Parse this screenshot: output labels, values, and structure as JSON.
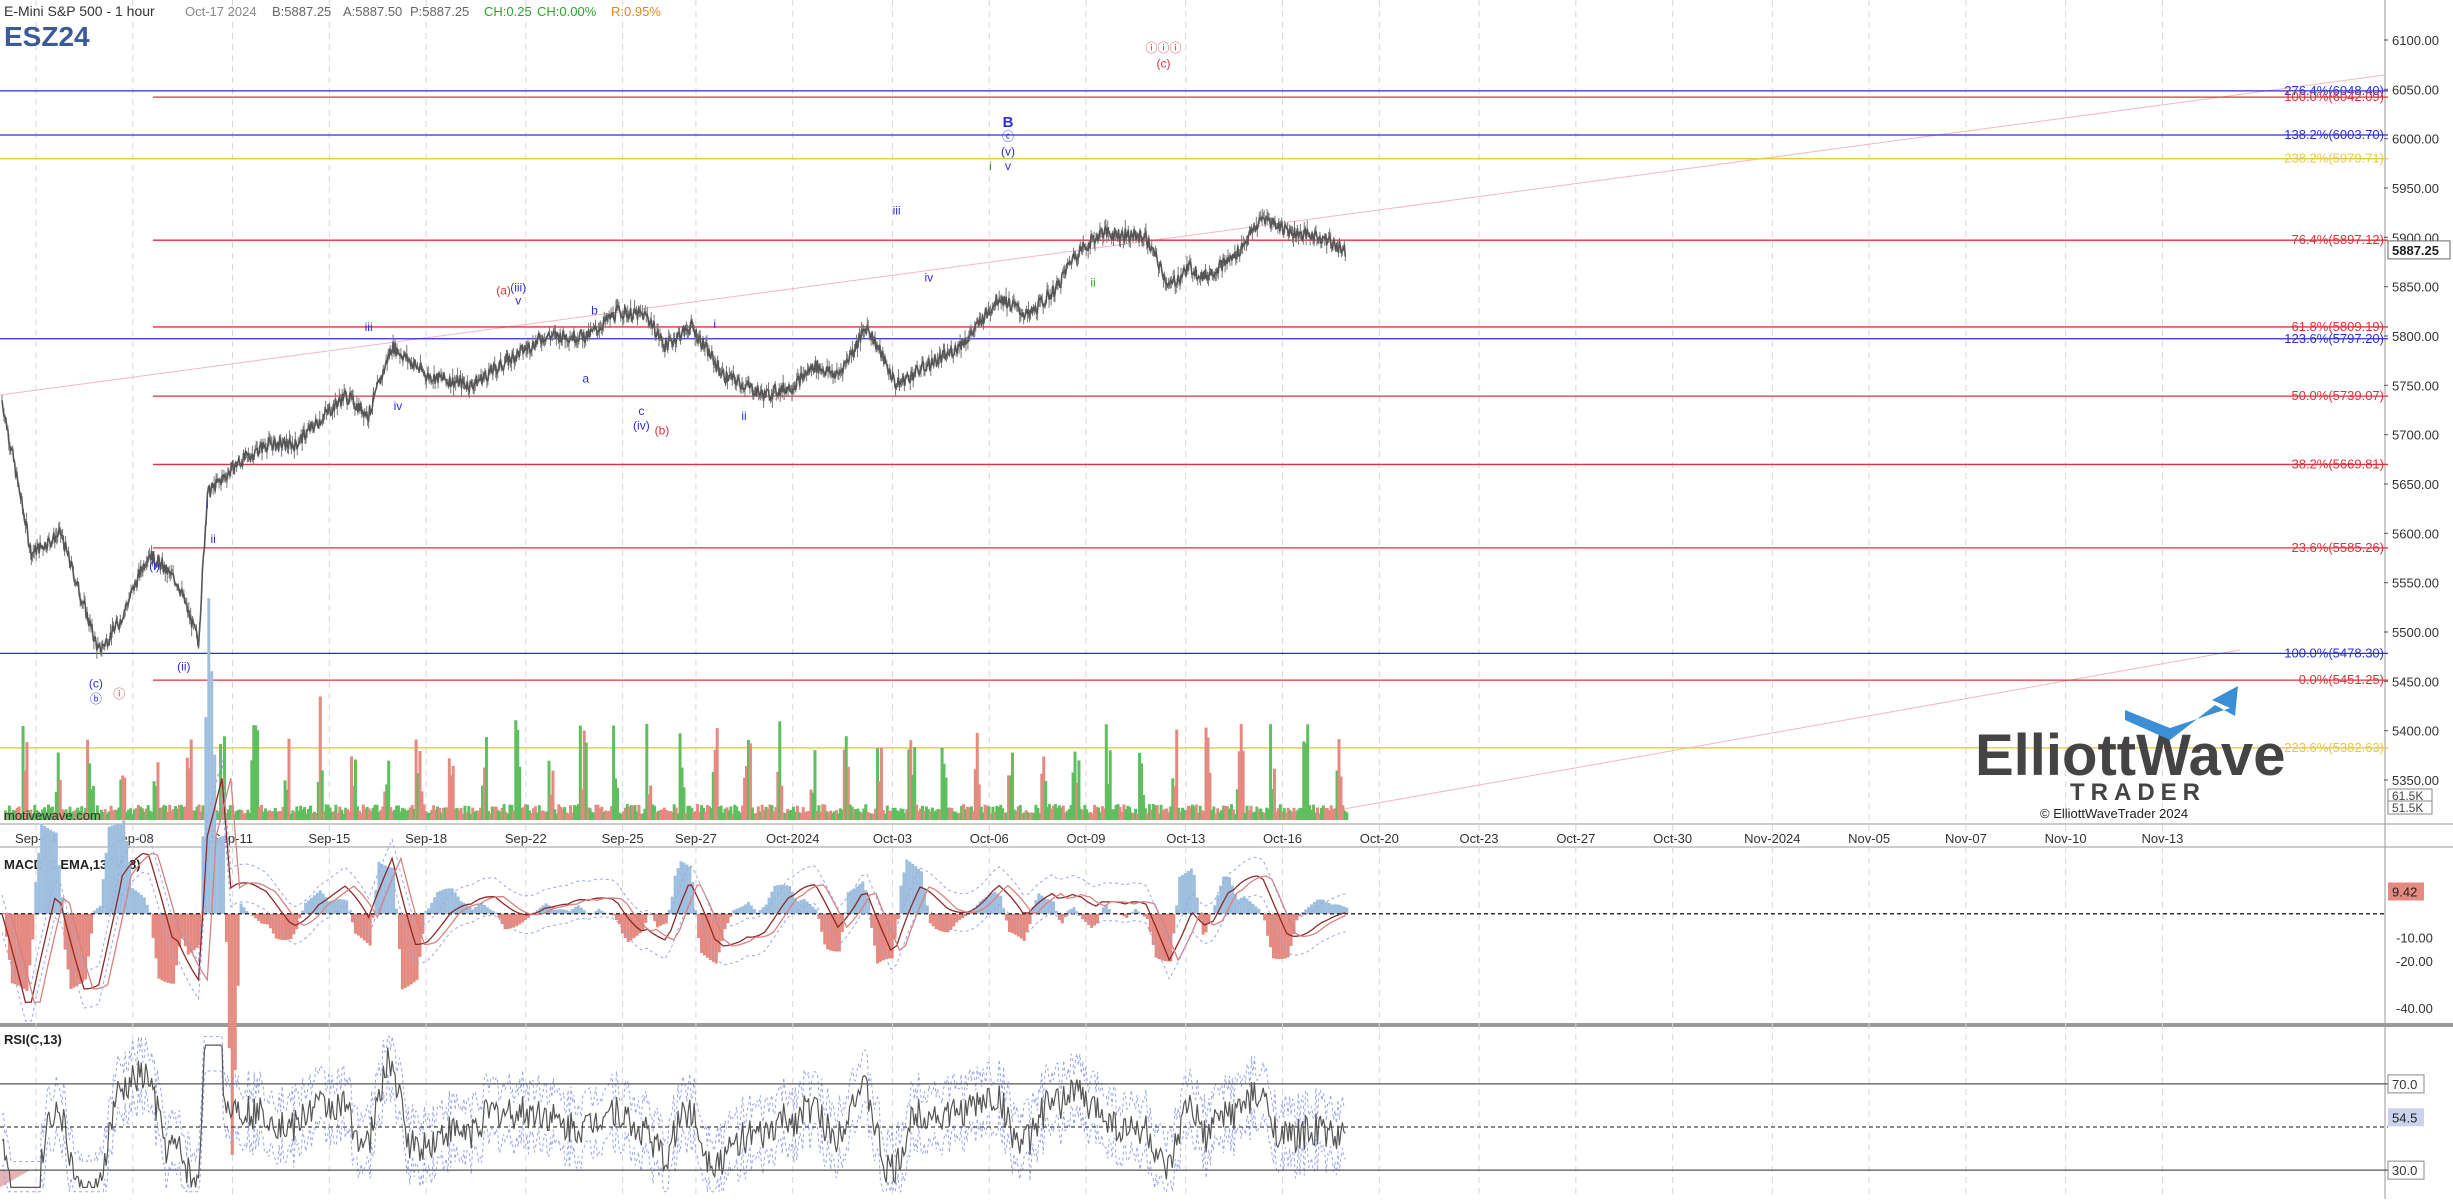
{
  "header": {
    "instrument": "E-Mini S&P 500 - 1 hour",
    "date": "Oct-17 2024",
    "bid": "B:5887.25",
    "ask": "A:5887.50",
    "price": "P:5887.25",
    "change": "CH:0.25",
    "change_pct": "CH:0.00%",
    "range": "R:0.95%",
    "symbol": "ESZ24"
  },
  "watermark": "motivewave.com",
  "logo": {
    "line1": "ElliottWave",
    "line2": "TRADER",
    "copyright": "© ElliottWaveTrader 2024"
  },
  "colors": {
    "price": "#666666",
    "fib_red": "#e0313a",
    "fib_blue": "#2d2fd6",
    "fib_yellow": "#e8c84a",
    "label_blue": "#2d2fd6",
    "label_red": "#e0313a",
    "label_green": "#3a9a2a",
    "vol_up": "#5fbf5f",
    "vol_down": "#e58a80",
    "macd_hist": "#9fbfdf",
    "rsi_fill": "#b9b9e6"
  },
  "chart_data": [
    {
      "type": "line",
      "title": "ESZ24",
      "ylim": [
        5330,
        6120
      ],
      "price_axis": {
        "ticks": [
          "6100.00",
          "6050.00",
          "6000.00",
          "5950.00",
          "5900.00",
          "5850.00",
          "5800.00",
          "5750.00",
          "5700.00",
          "5650.00",
          "5600.00",
          "5550.00",
          "5500.00",
          "5450.00",
          "5400.00",
          "5350.00"
        ],
        "tick_values": [
          6100,
          6050,
          6000,
          5950,
          5900,
          5850,
          5800,
          5750,
          5700,
          5650,
          5600,
          5550,
          5500,
          5450,
          5400,
          5350
        ],
        "last_price": "5887.25",
        "last_value": 5887.25,
        "volume_labels": [
          "61.5K",
          "51.5K"
        ]
      },
      "time_axis": {
        "ticks": [
          "Sep-04",
          "Sep-08",
          "Sep-11",
          "Sep-15",
          "Sep-18",
          "Sep-22",
          "Sep-25",
          "Sep-27",
          "Oct-2024",
          "Oct-03",
          "Oct-06",
          "Oct-09",
          "Oct-13",
          "Oct-16",
          "Oct-20",
          "Oct-23",
          "Oct-27",
          "Oct-30",
          "Nov-2024",
          "Nov-05",
          "Nov-07",
          "Nov-10",
          "Nov-13"
        ],
        "tick_index": [
          0,
          33,
          67,
          100,
          133,
          167,
          200,
          225,
          258,
          292,
          325,
          358,
          392,
          425,
          458,
          492,
          525,
          558,
          592,
          625,
          658,
          692,
          725
        ]
      },
      "series": [
        {
          "x_index": [
            0,
            10,
            20,
            33,
            40,
            50,
            60,
            67,
            70,
            80,
            90,
            100,
            110,
            117,
            125,
            133,
            145,
            160,
            175,
            185,
            200,
            210,
            220,
            226,
            235,
            246,
            250,
            260,
            270,
            277,
            285,
            295,
            305,
            315,
            322,
            330,
            340,
            350,
            360,
            365,
            375,
            390,
            398,
            405,
            410,
            420,
            430,
            440,
            450,
            458
          ],
          "values": [
            5735,
            5580,
            5600,
            5480,
            5510,
            5580,
            5550,
            5490,
            5640,
            5670,
            5690,
            5690,
            5720,
            5740,
            5720,
            5790,
            5760,
            5750,
            5780,
            5800,
            5800,
            5825,
            5820,
            5790,
            5810,
            5760,
            5755,
            5740,
            5750,
            5770,
            5760,
            5810,
            5750,
            5770,
            5780,
            5800,
            5840,
            5820,
            5850,
            5880,
            5905,
            5900,
            5850,
            5870,
            5860,
            5880,
            5920,
            5905,
            5900,
            5887.25
          ]
        }
      ],
      "fib_levels": [
        {
          "label": "276.4%(6048.40)",
          "value": 6048.4,
          "color": "#2d2fd6"
        },
        {
          "label": "100.0%(6042.09)",
          "value": 6042.09,
          "color": "#e0313a"
        },
        {
          "label": "138.2%(6003.70)",
          "value": 6003.7,
          "color": "#2d2fd6"
        },
        {
          "label": "238.2%(5979.71)",
          "value": 5979.71,
          "color": "#e8c84a"
        },
        {
          "label": "76.4%(5897.12)",
          "value": 5897.12,
          "color": "#e0313a"
        },
        {
          "label": "61.8%(5809.19)",
          "value": 5809.19,
          "color": "#e0313a"
        },
        {
          "label": "123.6%(5797.20)",
          "value": 5797.2,
          "color": "#2d2fd6"
        },
        {
          "label": "50.0%(5739.07)",
          "value": 5739.07,
          "color": "#e0313a"
        },
        {
          "label": "38.2%(5669.81)",
          "value": 5669.81,
          "color": "#e0313a"
        },
        {
          "label": "23.6%(5585.26)",
          "value": 5585.26,
          "color": "#e0313a"
        },
        {
          "label": "100.0%(5478.30)",
          "value": 5478.3,
          "color": "#2d2fd6"
        },
        {
          "label": "0.0%(5451.25)",
          "value": 5451.25,
          "color": "#e0313a"
        },
        {
          "label": "223.6%(5382.63)",
          "value": 5382.63,
          "color": "#e8c84a"
        }
      ],
      "wave_labels": [
        {
          "text": "(c)",
          "x_index": 32,
          "value": 5444,
          "color": "#2d2fd6"
        },
        {
          "text": "ⓑ",
          "x_index": 32,
          "value": 5428,
          "color": "#2d2fd6"
        },
        {
          "text": "ⓘ",
          "x_index": 40,
          "value": 5433,
          "color": "#e0313a"
        },
        {
          "text": "(i)",
          "x_index": 52,
          "value": 5563,
          "color": "#2d2fd6"
        },
        {
          "text": "(ii)",
          "x_index": 62,
          "value": 5461,
          "color": "#2d2fd6"
        },
        {
          "text": "i",
          "x_index": 70,
          "value": 5625,
          "color": "#2d2fd6"
        },
        {
          "text": "ii",
          "x_index": 72,
          "value": 5590,
          "color": "#2d2fd6"
        },
        {
          "text": "iii",
          "x_index": 125,
          "value": 5805,
          "color": "#2d2fd6"
        },
        {
          "text": "iv",
          "x_index": 135,
          "value": 5725,
          "color": "#2d2fd6"
        },
        {
          "text": "(a)",
          "x_index": 171,
          "value": 5842,
          "color": "#e0313a"
        },
        {
          "text": "(iii)",
          "x_index": 176,
          "value": 5845,
          "color": "#2d2fd6"
        },
        {
          "text": "v",
          "x_index": 176,
          "value": 5832,
          "color": "#2d2fd6"
        },
        {
          "text": "b",
          "x_index": 202,
          "value": 5822,
          "color": "#2d2fd6"
        },
        {
          "text": "a",
          "x_index": 199,
          "value": 5753,
          "color": "#2d2fd6"
        },
        {
          "text": "c",
          "x_index": 218,
          "value": 5720,
          "color": "#2d2fd6"
        },
        {
          "text": "(iv)",
          "x_index": 218,
          "value": 5705,
          "color": "#2d2fd6"
        },
        {
          "text": "(b)",
          "x_index": 225,
          "value": 5700,
          "color": "#e0313a"
        },
        {
          "text": "i",
          "x_index": 243,
          "value": 5808,
          "color": "#2d2fd6"
        },
        {
          "text": "ii",
          "x_index": 253,
          "value": 5715,
          "color": "#2d2fd6"
        },
        {
          "text": "iii",
          "x_index": 305,
          "value": 5923,
          "color": "#2d2fd6"
        },
        {
          "text": "iv",
          "x_index": 316,
          "value": 5855,
          "color": "#2d2fd6"
        },
        {
          "text": "i",
          "x_index": 337,
          "value": 5968,
          "color": "#3a9a2a"
        },
        {
          "text": "B",
          "x_index": 343,
          "value": 6012,
          "color": "#2d2fd6"
        },
        {
          "text": "ⓒ",
          "x_index": 343,
          "value": 5998,
          "color": "#2d2fd6"
        },
        {
          "text": "(v)",
          "x_index": 343,
          "value": 5983,
          "color": "#2d2fd6"
        },
        {
          "text": "v",
          "x_index": 343,
          "value": 5968,
          "color": "#2d2fd6"
        },
        {
          "text": "ii",
          "x_index": 372,
          "value": 5850,
          "color": "#3a9a2a"
        },
        {
          "text": "ⓘⓘⓘ",
          "x_index": 396,
          "value": 6088,
          "color": "#e0313a"
        },
        {
          "text": "(c)",
          "x_index": 396,
          "value": 6072,
          "color": "#e0313a"
        }
      ]
    },
    {
      "type": "line",
      "title": "MACD(C,EMA,13,34,8)",
      "ylim": [
        -45,
        27
      ],
      "ticks": [
        "-10.00",
        "-20.00",
        "-40.00"
      ],
      "tick_values": [
        -10,
        -20,
        -40
      ],
      "last_value_label": "9.42",
      "last_value": 9.42
    },
    {
      "type": "line",
      "title": "RSI(C,13)",
      "ylim": [
        18,
        95
      ],
      "ticks": [
        "70.0",
        "30.0"
      ],
      "tick_values": [
        70,
        30
      ],
      "last_value_label": "54.5",
      "last_value": 54.5
    }
  ]
}
